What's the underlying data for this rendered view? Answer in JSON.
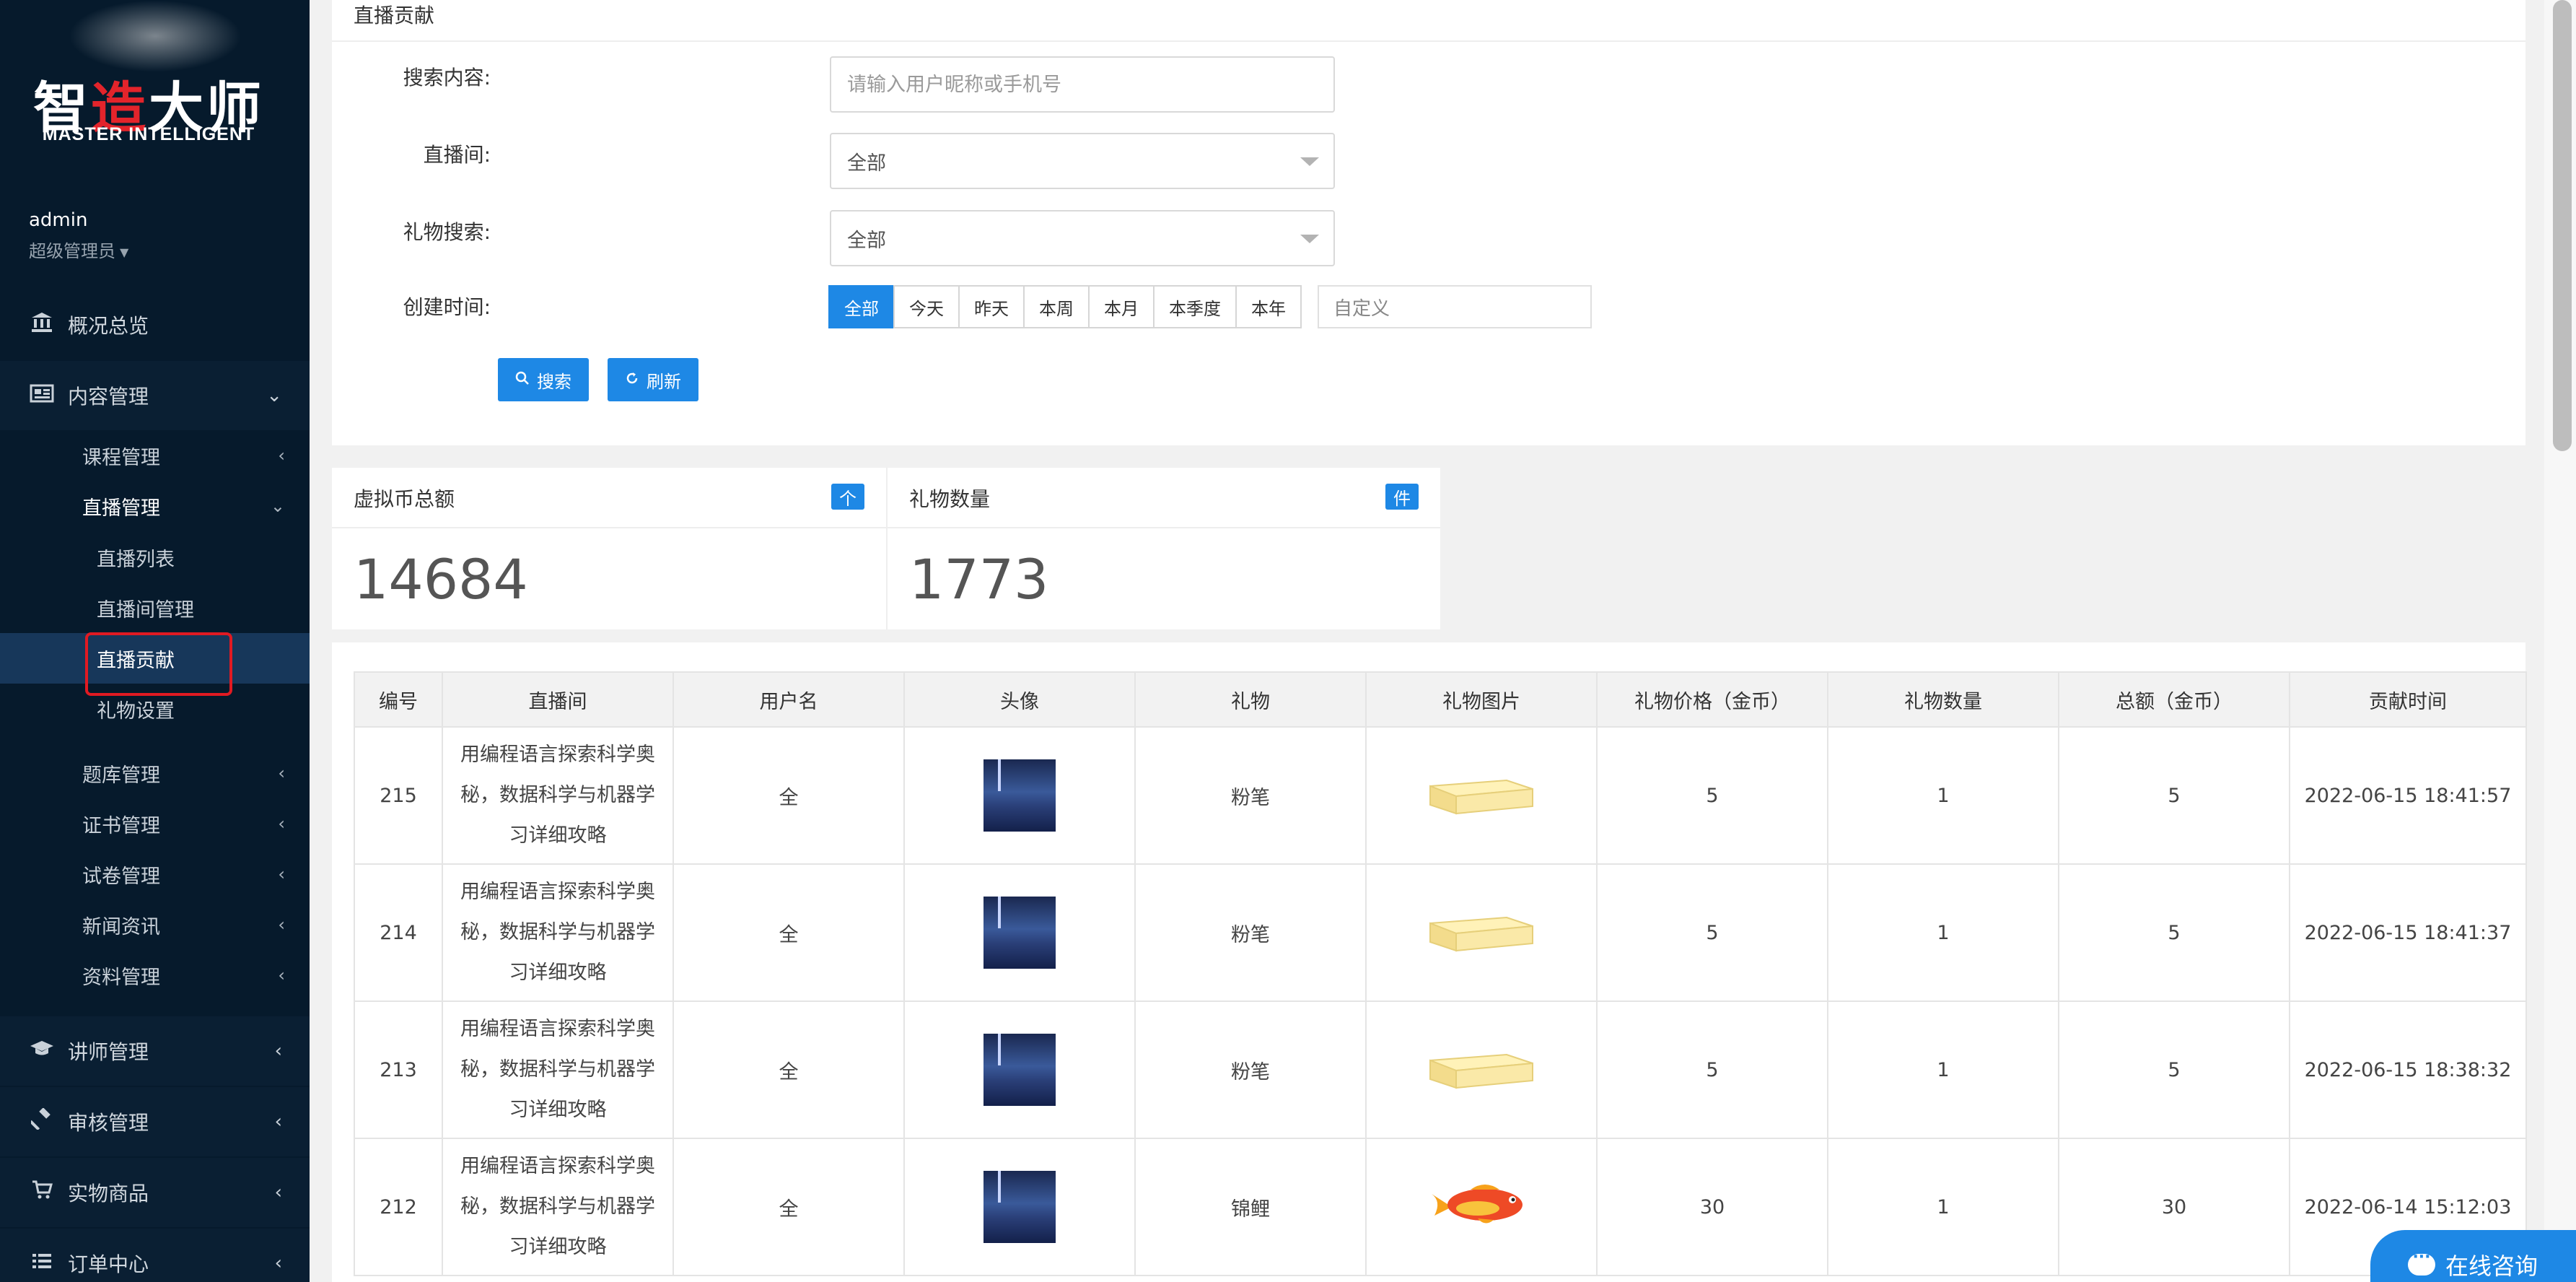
{
  "brand": {
    "title_a": "智",
    "title_accent": "造",
    "title_b": "大师",
    "subtitle": "MASTER INTELLIGENT"
  },
  "user": {
    "name": "admin",
    "role": "超级管理员"
  },
  "sidebar": {
    "overview": "概况总览",
    "content": "内容管理",
    "course": "课程管理",
    "live": "直播管理",
    "live_list": "直播列表",
    "live_room": "直播间管理",
    "live_contrib": "直播贡献",
    "gift_setting": "礼物设置",
    "question_bank": "题库管理",
    "certificate": "证书管理",
    "exam_paper": "试卷管理",
    "news": "新闻资讯",
    "material": "资料管理",
    "teacher": "讲师管理",
    "audit": "审核管理",
    "product": "实物商品",
    "order": "订单中心"
  },
  "search": {
    "title": "直播贡献",
    "content_label": "搜索内容:",
    "content_placeholder": "请输入用户昵称或手机号",
    "room_label": "直播间:",
    "room_value": "全部",
    "gift_label": "礼物搜索:",
    "gift_value": "全部",
    "time_label": "创建时间:",
    "time_options": [
      "全部",
      "今天",
      "昨天",
      "本周",
      "本月",
      "本季度",
      "本年"
    ],
    "custom_placeholder": "自定义",
    "search_btn": "搜索",
    "refresh_btn": "刷新"
  },
  "stats": {
    "coin_title": "虚拟币总额",
    "coin_badge": "个",
    "coin_value": "14684",
    "gift_title": "礼物数量",
    "gift_badge": "件",
    "gift_value": "1773"
  },
  "table": {
    "headers": [
      "编号",
      "直播间",
      "用户名",
      "头像",
      "礼物",
      "礼物图片",
      "礼物价格（金币）",
      "礼物数量",
      "总额（金币）",
      "贡献时间"
    ],
    "rows": [
      {
        "id": "215",
        "room": "用编程语言探索科学奥秘，数据科学与机器学习详细攻略",
        "user": "全",
        "gift": "粉笔",
        "price": "5",
        "qty": "1",
        "total": "5",
        "time": "2022-06-15 18:41:57"
      },
      {
        "id": "214",
        "room": "用编程语言探索科学奥秘，数据科学与机器学习详细攻略",
        "user": "全",
        "gift": "粉笔",
        "price": "5",
        "qty": "1",
        "total": "5",
        "time": "2022-06-15 18:41:37"
      },
      {
        "id": "213",
        "room": "用编程语言探索科学奥秘，数据科学与机器学习详细攻略",
        "user": "全",
        "gift": "粉笔",
        "price": "5",
        "qty": "1",
        "total": "5",
        "time": "2022-06-15 18:38:32"
      },
      {
        "id": "212",
        "room": "用编程语言探索科学奥秘，数据科学与机器学习详细攻略",
        "user": "全",
        "gift": "锦鲤",
        "price": "30",
        "qty": "1",
        "total": "30",
        "time": "2022-06-14 15:12:03"
      }
    ]
  },
  "consult": "在线咨询",
  "colors": {
    "sidebar_bg": "#061a2c",
    "accent": "#1e88e5",
    "highlight": "#e11a22"
  }
}
